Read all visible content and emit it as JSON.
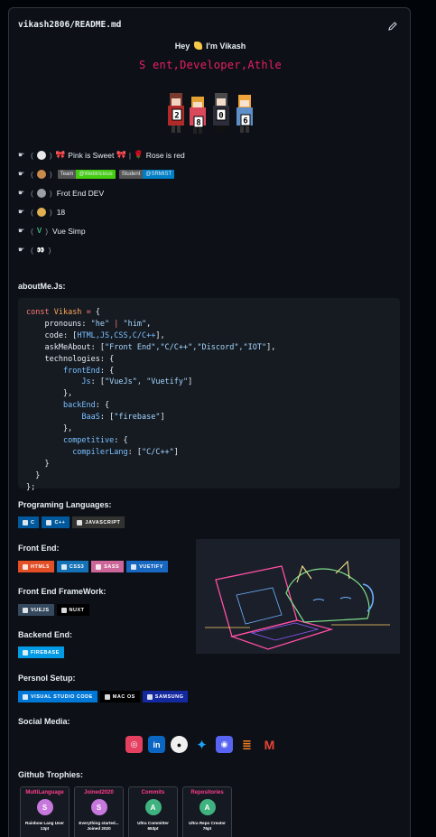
{
  "file": {
    "path": "vikash2806/README.md",
    "edit_icon": "pencil-icon"
  },
  "greeting": {
    "text": "Hey",
    "emoji": "wave-icon",
    "name": "I'm Vikash"
  },
  "typing_text": "S   ent,Developer,Athle",
  "counter_digits": [
    "2",
    "8",
    "0",
    "6"
  ],
  "list": [
    {
      "text": "Pink is Sweet",
      "mid": "Rose is red"
    },
    {
      "badges": [
        {
          "l": "Team",
          "r": "@Webtricious"
        },
        {
          "l": "Student",
          "r": "@SRMIST"
        }
      ]
    },
    {
      "text": "Frot End DEV"
    },
    {
      "text": "18"
    },
    {
      "text": "Vue Simp"
    },
    {
      "text": ""
    }
  ],
  "about": {
    "title": "aboutMe.Js:",
    "name": "Vikash",
    "pronouns_a": "\"he\"",
    "pronouns_b": "\"him\"",
    "code_list": "HTML,JS,CSS,C/C++",
    "ask_list": "\"Front End\",\"C/C++\",\"Discord\",\"IOT\"",
    "js": "\"VueJs\", \"Vuetify\"",
    "baas": "\"firebase\"",
    "compiler": "\"C/C++\""
  },
  "sections": {
    "languages": "Programing Languages:",
    "frontend": "Front End:",
    "framework": "Front End FrameWork:",
    "backend": "Backend End:",
    "setup": "Persnol Setup:",
    "social": "Social Media:",
    "trophies": "Github Trophies:"
  },
  "badges": {
    "languages": [
      {
        "t": "C",
        "c": "#00599c"
      },
      {
        "t": "C++",
        "c": "#00599c"
      },
      {
        "t": "JAVASCRIPT",
        "c": "#323330"
      }
    ],
    "frontend": [
      {
        "t": "HTML5",
        "c": "#e34f26"
      },
      {
        "t": "CSS3",
        "c": "#1572b6"
      },
      {
        "t": "SASS",
        "c": "#cc6699"
      },
      {
        "t": "VUETIFY",
        "c": "#1867c0"
      }
    ],
    "framework": [
      {
        "t": "VUEJS",
        "c": "#35495e"
      },
      {
        "t": "NUXT",
        "c": "#000000"
      }
    ],
    "backend": [
      {
        "t": "FIREBASE",
        "c": "#039be5"
      }
    ],
    "setup": [
      {
        "t": "VISUAL STUDIO CODE",
        "c": "#0078d7"
      },
      {
        "t": "MAC OS",
        "c": "#000000"
      },
      {
        "t": "SAMSUNG",
        "c": "#1428a0"
      }
    ]
  },
  "social": [
    {
      "icon": "instagram-icon",
      "c": "#e4405f"
    },
    {
      "icon": "linkedin-icon",
      "c": "#0a66c2"
    },
    {
      "icon": "github-icon",
      "c": "#333333"
    },
    {
      "icon": "twitter-icon",
      "c": "#1da1f2"
    },
    {
      "icon": "discord-icon",
      "c": "#5865f2"
    },
    {
      "icon": "stackoverflow-icon",
      "c": "#f48024"
    },
    {
      "icon": "gmail-icon",
      "c": "#ea4335"
    }
  ],
  "trophies": [
    {
      "title": "MultiLanguage",
      "rank": "S",
      "l1": "Rainbow Lang User",
      "l2": "13pt",
      "c": "#c678dd"
    },
    {
      "title": "Joined2020",
      "rank": "S",
      "l1": "Everything started...",
      "l2": "Joined 2020",
      "c": "#c678dd"
    },
    {
      "title": "Commits",
      "rank": "A",
      "l1": "Ultra Committer",
      "l2": "653pt",
      "c": "#6ee7a0"
    },
    {
      "title": "Repositories",
      "rank": "A",
      "l1": "Ultra Repo Creator",
      "l2": "76pt",
      "c": "#6ee7a0"
    }
  ]
}
